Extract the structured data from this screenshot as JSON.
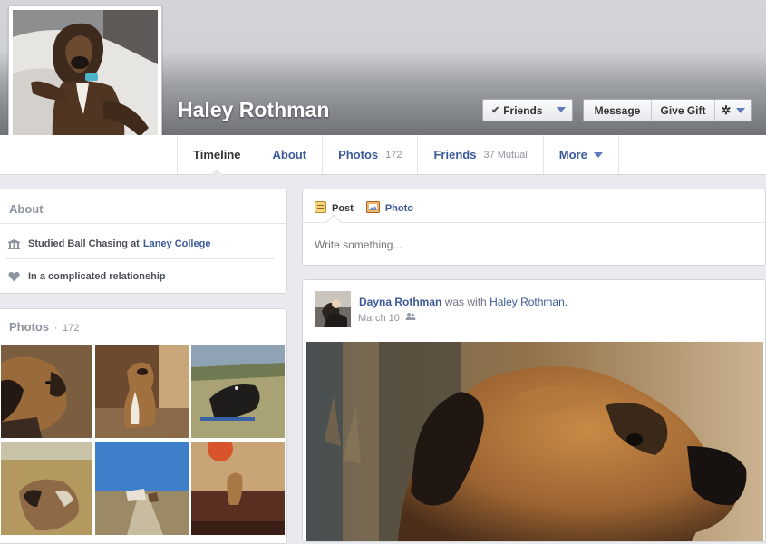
{
  "profile": {
    "name": "Haley Rothman"
  },
  "actions": {
    "friends_label": "Friends",
    "message_label": "Message",
    "gift_label": "Give Gift"
  },
  "tabs": [
    {
      "label": "Timeline",
      "active": true
    },
    {
      "label": "About"
    },
    {
      "label": "Photos",
      "count": "172"
    },
    {
      "label": "Friends",
      "count": "37 Mutual"
    },
    {
      "label": "More"
    }
  ],
  "about": {
    "title": "About",
    "education_prefix": "Studied Ball Chasing at",
    "education_school": "Laney College",
    "relationship": "In a complicated relationship"
  },
  "photos": {
    "title": "Photos",
    "separator": "·",
    "count": "172"
  },
  "composer": {
    "post_label": "Post",
    "photo_label": "Photo",
    "placeholder": "Write something..."
  },
  "story": {
    "author": "Dayna Rothman",
    "connector": "was with",
    "tagged": "Haley Rothman.",
    "date": "March 10"
  },
  "icons": {
    "check": "check-icon",
    "gear": "gear-icon",
    "education": "school-icon",
    "relationship": "heart-icon",
    "post": "post-icon",
    "photo": "photo-icon",
    "audience": "friends-audience-icon"
  }
}
